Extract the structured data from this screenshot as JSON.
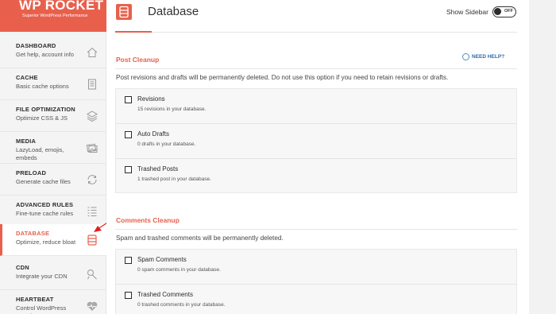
{
  "logo": {
    "title": "WP ROCKET",
    "subtitle": "Superior WordPress Performance"
  },
  "sidebar": {
    "items": [
      {
        "title": "DASHBOARD",
        "desc": "Get help, account info",
        "icon": "house-icon"
      },
      {
        "title": "CACHE",
        "desc": "Basic cache options",
        "icon": "document-icon"
      },
      {
        "title": "FILE OPTIMIZATION",
        "desc": "Optimize CSS & JS",
        "icon": "layers-icon"
      },
      {
        "title": "MEDIA",
        "desc": "LazyLoad, emojis, embeds",
        "icon": "images-icon"
      },
      {
        "title": "PRELOAD",
        "desc": "Generate cache files",
        "icon": "refresh-icon"
      },
      {
        "title": "ADVANCED RULES",
        "desc": "Fine-tune cache rules",
        "icon": "list-icon"
      },
      {
        "title": "DATABASE",
        "desc": "Optimize, reduce bloat",
        "icon": "database-icon"
      },
      {
        "title": "CDN",
        "desc": "Integrate your CDN",
        "icon": "cdn-icon"
      },
      {
        "title": "HEARTBEAT",
        "desc": "Control WordPress Heartbeat API",
        "icon": "heartbeat-icon"
      }
    ]
  },
  "header": {
    "title": "Database",
    "show_sidebar_label": "Show Sidebar",
    "toggle_state": "OFF"
  },
  "post_cleanup": {
    "title": "Post Cleanup",
    "need_help": "NEED HELP?",
    "description": "Post revisions and drafts will be permanently deleted. Do not use this option if you need to retain revisions or drafts.",
    "options": [
      {
        "label": "Revisions",
        "sub": "15 revisions in your database."
      },
      {
        "label": "Auto Drafts",
        "sub": "0 drafts in your database."
      },
      {
        "label": "Trashed Posts",
        "sub": "1 trashed post in your database."
      }
    ]
  },
  "comments_cleanup": {
    "title": "Comments Cleanup",
    "description": "Spam and trashed comments will be permanently deleted.",
    "options": [
      {
        "label": "Spam Comments",
        "sub": "0 spam comments in your database."
      },
      {
        "label": "Trashed Comments",
        "sub": "0 trashed comments in your database."
      }
    ]
  },
  "colors": {
    "accent": "#e8604c",
    "link": "#2a6aa8"
  }
}
